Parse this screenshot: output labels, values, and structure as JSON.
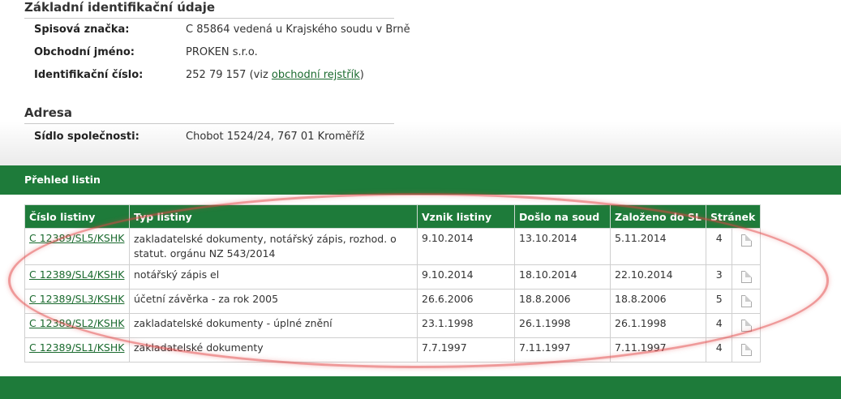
{
  "basic": {
    "heading": "Základní identifikační údaje",
    "file_no_label": "Spisová značka:",
    "file_no_value": "C 85864 vedená u Krajského soudu v Brně",
    "name_label": "Obchodní jméno:",
    "name_value": "PROKEN s.r.o.",
    "id_label": "Identifikační číslo:",
    "id_value": "252 79 157",
    "id_note_pre": "(viz ",
    "id_link": "obchodní rejstřík",
    "id_note_post": ")"
  },
  "address": {
    "heading": "Adresa",
    "seat_label": "Sídlo společnosti:",
    "seat_value": "Chobot 1524/24, 767 01 Kroměříž"
  },
  "documents": {
    "band_title": "Přehled listin",
    "columns": [
      "Číslo listiny",
      "Typ listiny",
      "Vznik listiny",
      "Došlo na soud",
      "Založeno do SL",
      "Stránek"
    ],
    "rows": [
      {
        "number": "C 12389/SL5/KSHK",
        "type": "zakladatelské dokumenty, notářský zápis, rozhod. o statut. orgánu NZ 543/2014",
        "created": "9.10.2014",
        "received": "13.10.2014",
        "filed": "5.11.2014",
        "pages": "4"
      },
      {
        "number": "C 12389/SL4/KSHK",
        "type": "notářský zápis el",
        "created": "9.10.2014",
        "received": "18.10.2014",
        "filed": "22.10.2014",
        "pages": "3"
      },
      {
        "number": "C 12389/SL3/KSHK",
        "type": "účetní závěrka - za rok 2005",
        "created": "26.6.2006",
        "received": "18.8.2006",
        "filed": "18.8.2006",
        "pages": "5"
      },
      {
        "number": "C 12389/SL2/KSHK",
        "type": "zakladatelské dokumenty - úplné znění",
        "created": "23.1.1998",
        "received": "26.1.1998",
        "filed": "26.1.1998",
        "pages": "4"
      },
      {
        "number": "C 12389/SL1/KSHK",
        "type": "zakladatelské dokumenty",
        "created": "7.7.1997",
        "received": "7.11.1997",
        "filed": "7.11.1997",
        "pages": "4"
      }
    ]
  },
  "colors": {
    "green": "#1e7b3a",
    "link": "#1a6a2e",
    "annotation": "#e14646"
  },
  "icons": {
    "document": "document-icon"
  }
}
